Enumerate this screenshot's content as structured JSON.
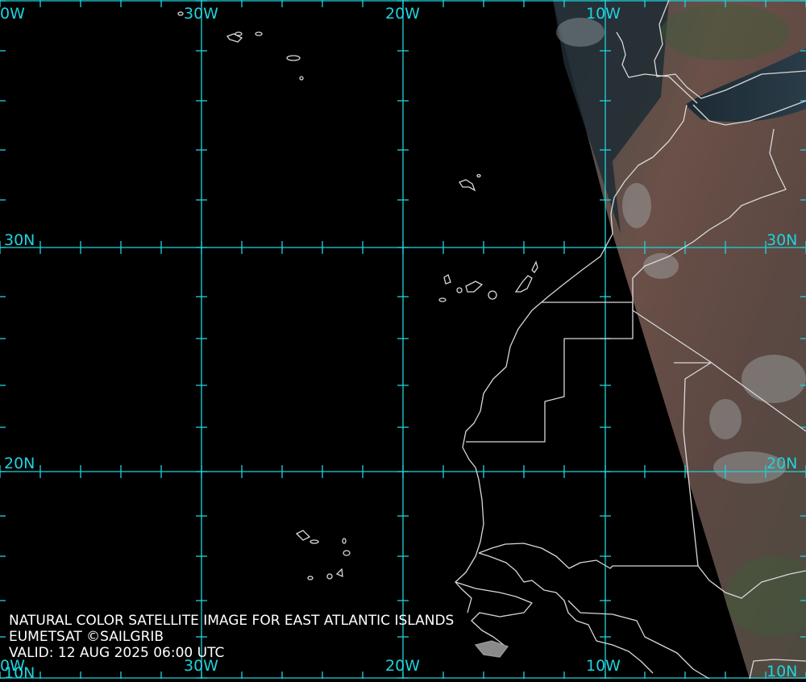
{
  "map": {
    "caption": {
      "title": "NATURAL COLOR SATELLITE IMAGE FOR EAST ATLANTIC ISLANDS",
      "credit": "EUMETSAT ©SAILGRIB",
      "valid": "VALID:  12 AUG 2025 06:00 UTC"
    },
    "grid_labels": {
      "lon_40w_top": "0W",
      "lon_30w_top": "30W",
      "lon_20w_top": "20W",
      "lon_10w_top": "10W",
      "lat_30n_left": "30N",
      "lat_30n_right": "30N",
      "lat_20n_left": "20N",
      "lat_20n_right": "20N",
      "lon_40w_bottom": "0W",
      "lat_10n_left": "10N",
      "lon_30w_bottom": "30W",
      "lon_20w_bottom": "20W",
      "lon_10w_bottom": "10W",
      "lat_10n_right": "10N"
    },
    "colors": {
      "grid": "#1ed3de",
      "coastline": "#d8d8d8",
      "ocean": "#000000",
      "land_imagery": "#5e4a43"
    }
  }
}
